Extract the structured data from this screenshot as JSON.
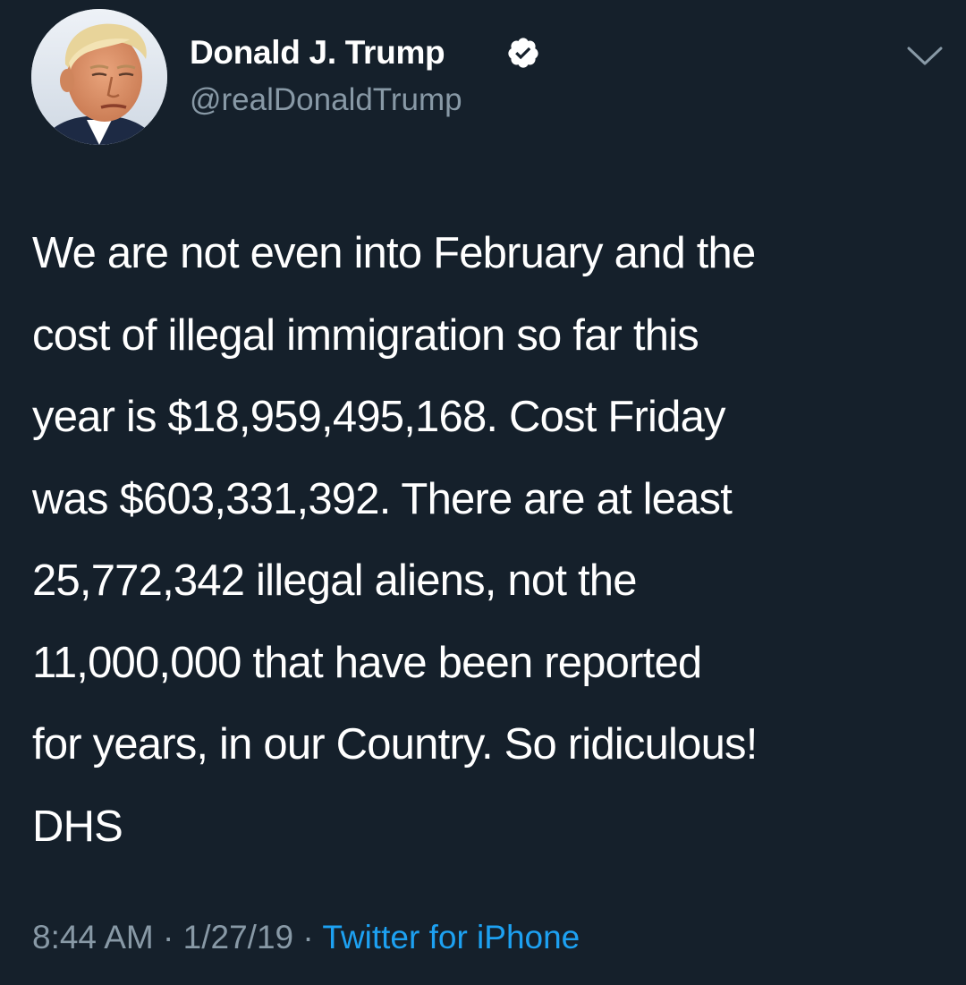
{
  "tweet": {
    "author": {
      "display_name": "Donald J. Trump",
      "handle": "@realDonaldTrump",
      "verified": true,
      "avatar_icon": "profile-photo"
    },
    "menu_icon": "chevron-down-icon",
    "text_lines": [
      "We are not even into February and the",
      "cost of illegal immigration so far this",
      "year is $18,959,495,168. Cost Friday",
      "was $603,331,392. There are at least",
      "25,772,342 illegal aliens, not the",
      "11,000,000 that have been reported",
      "for years, in our Country. So ridiculous!",
      "DHS"
    ],
    "time": "8:44 AM",
    "separator": "·",
    "date": "1/27/19",
    "source": "Twitter for iPhone"
  },
  "colors": {
    "background": "#15202b",
    "text": "#ffffff",
    "secondary_text": "#8899a6",
    "link": "#1da1f2",
    "verified_badge": "#ffffff"
  }
}
